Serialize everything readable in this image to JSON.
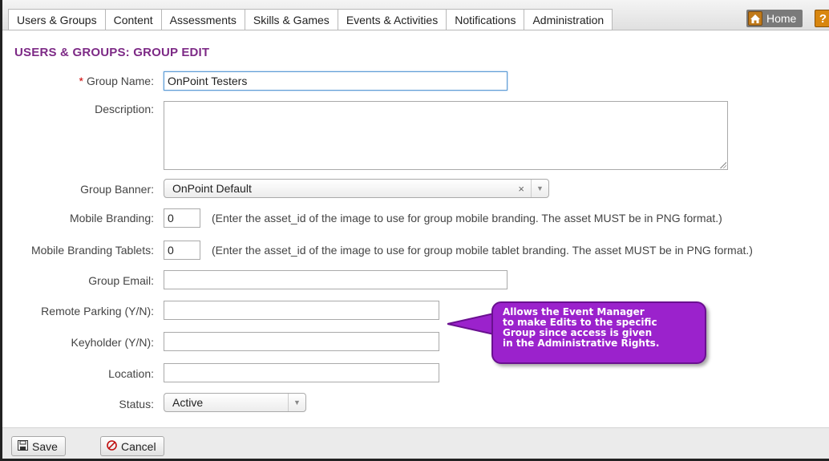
{
  "nav": {
    "tabs": [
      "Users & Groups",
      "Content",
      "Assessments",
      "Skills & Games",
      "Events & Activities",
      "Notifications",
      "Administration"
    ],
    "home_label": "Home",
    "help_glyph": "?"
  },
  "page": {
    "title": "USERS & GROUPS: GROUP EDIT"
  },
  "form": {
    "required_marker": "*",
    "group_name": {
      "label": "Group Name:",
      "value": "OnPoint Testers"
    },
    "description": {
      "label": "Description:",
      "value": ""
    },
    "group_banner": {
      "label": "Group Banner:",
      "value": "OnPoint Default",
      "clear_glyph": "×",
      "arrow_glyph": "▼"
    },
    "mobile_branding": {
      "label": "Mobile Branding:",
      "value": "0",
      "help": "(Enter the asset_id of the image to use for group mobile branding. The asset MUST be in PNG format.)"
    },
    "mobile_branding_tablets": {
      "label": "Mobile Branding Tablets:",
      "value": "0",
      "help": "(Enter the asset_id of the image to use for group mobile tablet branding. The asset MUST be in PNG format.)"
    },
    "group_email": {
      "label": "Group Email:",
      "value": ""
    },
    "remote_parking": {
      "label": "Remote Parking (Y/N):",
      "value": ""
    },
    "keyholder": {
      "label": "Keyholder (Y/N):",
      "value": ""
    },
    "location": {
      "label": "Location:",
      "value": ""
    },
    "status": {
      "label": "Status:",
      "value": "Active",
      "arrow_glyph": "▼"
    }
  },
  "callout": {
    "lines": [
      "Allows the Event Manager",
      "to make Edits to the specific",
      "Group since access is given",
      "in the Administrative Rights."
    ]
  },
  "footer": {
    "save_label": "Save",
    "cancel_label": "Cancel"
  },
  "colors": {
    "title": "#7d2a86",
    "callout_fill": "#9b22cc",
    "callout_border": "#6a1090",
    "required": "#cc0000"
  }
}
